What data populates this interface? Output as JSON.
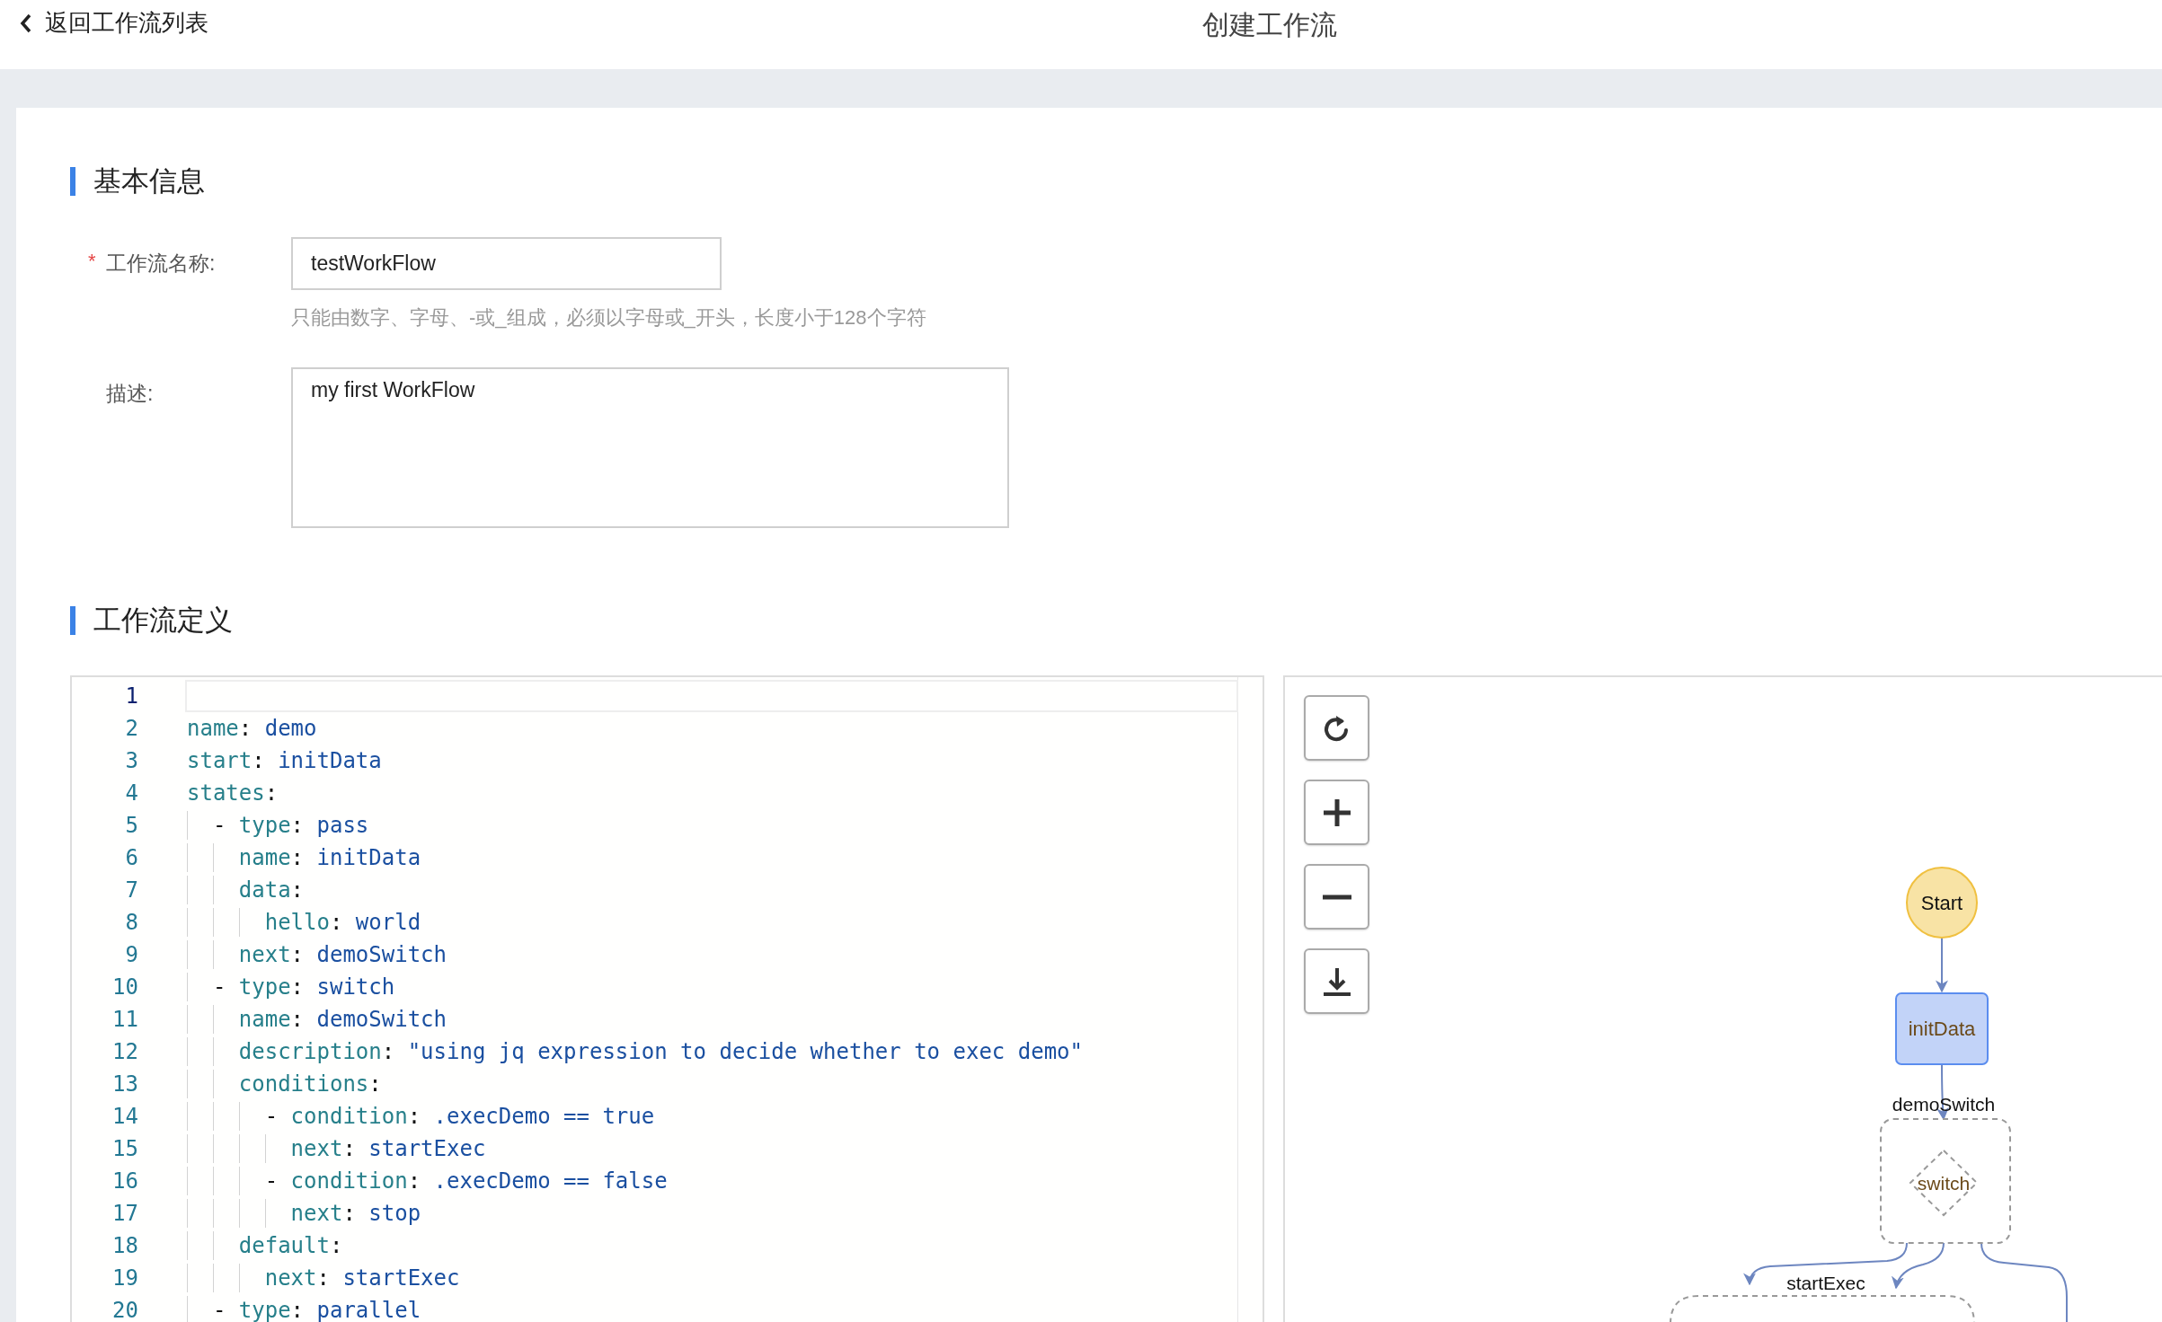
{
  "header": {
    "back_label": "返回工作流列表",
    "title": "创建工作流"
  },
  "basic_section": {
    "heading": "基本信息",
    "name_field": {
      "label": "工作流名称:",
      "required_mark": "*",
      "value": "testWorkFlow",
      "hint": "只能由数字、字母、-或_组成，必须以字母或_开头，长度小于128个字符"
    },
    "description_field": {
      "label": "描述:",
      "value": "my first WorkFlow"
    }
  },
  "definition_section": {
    "heading": "工作流定义",
    "editor": {
      "lines": [
        {
          "number": "1",
          "selected": true
        },
        {
          "number": "2",
          "text": "name: demo",
          "selected": false
        },
        {
          "number": "3",
          "text": "start: initData",
          "selected": false
        },
        {
          "number": "4",
          "text": "states:",
          "selected": false
        },
        {
          "number": "5",
          "text": "  - type: pass",
          "selected": false
        },
        {
          "number": "6",
          "text": "    name: initData",
          "selected": false
        },
        {
          "number": "7",
          "text": "    data:",
          "selected": false
        },
        {
          "number": "8",
          "text": "      hello: world",
          "selected": false
        },
        {
          "number": "9",
          "text": "    next: demoSwitch",
          "selected": false
        },
        {
          "number": "10",
          "text": "  - type: switch",
          "selected": false
        },
        {
          "number": "11",
          "text": "    name: demoSwitch",
          "selected": false
        },
        {
          "number": "12",
          "text": "    description: \"using jq expression to decide whether to exec demo\"",
          "selected": false
        },
        {
          "number": "13",
          "text": "    conditions:",
          "selected": false
        },
        {
          "number": "14",
          "text": "      - condition: .execDemo == true",
          "selected": false
        },
        {
          "number": "15",
          "text": "        next: startExec",
          "selected": false
        },
        {
          "number": "16",
          "text": "      - condition: .execDemo == false",
          "selected": false
        },
        {
          "number": "17",
          "text": "        next: stop",
          "selected": false
        },
        {
          "number": "18",
          "text": "    default:",
          "selected": false
        },
        {
          "number": "19",
          "text": "      next: startExec",
          "selected": false
        },
        {
          "number": "20",
          "text": "  - type: parallel",
          "selected": false
        }
      ]
    },
    "diagram": {
      "tools": [
        {
          "kind": "reset"
        },
        {
          "kind": "zoom_in"
        },
        {
          "kind": "zoom_out"
        },
        {
          "kind": "download"
        }
      ],
      "nodes": [
        {
          "kind": "start",
          "label": "Start"
        },
        {
          "kind": "state",
          "label": "initData"
        },
        {
          "kind": "switch",
          "label": "switch",
          "group_label": "demoSwitch"
        },
        {
          "kind": "group",
          "group_label": "startExec"
        }
      ]
    }
  }
}
